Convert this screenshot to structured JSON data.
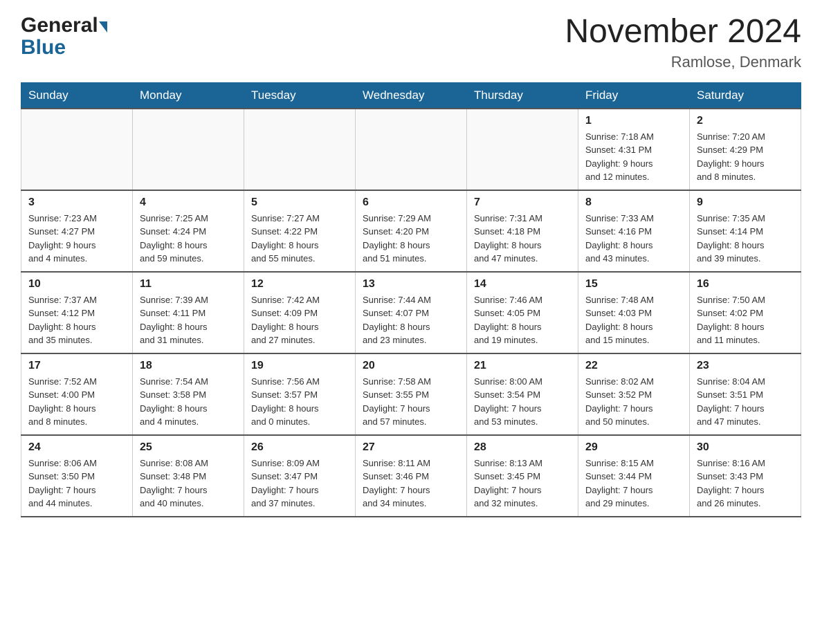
{
  "header": {
    "logo_general": "General",
    "logo_blue": "Blue",
    "month_title": "November 2024",
    "location": "Ramlose, Denmark"
  },
  "weekdays": [
    "Sunday",
    "Monday",
    "Tuesday",
    "Wednesday",
    "Thursday",
    "Friday",
    "Saturday"
  ],
  "weeks": [
    [
      {
        "day": "",
        "info": ""
      },
      {
        "day": "",
        "info": ""
      },
      {
        "day": "",
        "info": ""
      },
      {
        "day": "",
        "info": ""
      },
      {
        "day": "",
        "info": ""
      },
      {
        "day": "1",
        "info": "Sunrise: 7:18 AM\nSunset: 4:31 PM\nDaylight: 9 hours\nand 12 minutes."
      },
      {
        "day": "2",
        "info": "Sunrise: 7:20 AM\nSunset: 4:29 PM\nDaylight: 9 hours\nand 8 minutes."
      }
    ],
    [
      {
        "day": "3",
        "info": "Sunrise: 7:23 AM\nSunset: 4:27 PM\nDaylight: 9 hours\nand 4 minutes."
      },
      {
        "day": "4",
        "info": "Sunrise: 7:25 AM\nSunset: 4:24 PM\nDaylight: 8 hours\nand 59 minutes."
      },
      {
        "day": "5",
        "info": "Sunrise: 7:27 AM\nSunset: 4:22 PM\nDaylight: 8 hours\nand 55 minutes."
      },
      {
        "day": "6",
        "info": "Sunrise: 7:29 AM\nSunset: 4:20 PM\nDaylight: 8 hours\nand 51 minutes."
      },
      {
        "day": "7",
        "info": "Sunrise: 7:31 AM\nSunset: 4:18 PM\nDaylight: 8 hours\nand 47 minutes."
      },
      {
        "day": "8",
        "info": "Sunrise: 7:33 AM\nSunset: 4:16 PM\nDaylight: 8 hours\nand 43 minutes."
      },
      {
        "day": "9",
        "info": "Sunrise: 7:35 AM\nSunset: 4:14 PM\nDaylight: 8 hours\nand 39 minutes."
      }
    ],
    [
      {
        "day": "10",
        "info": "Sunrise: 7:37 AM\nSunset: 4:12 PM\nDaylight: 8 hours\nand 35 minutes."
      },
      {
        "day": "11",
        "info": "Sunrise: 7:39 AM\nSunset: 4:11 PM\nDaylight: 8 hours\nand 31 minutes."
      },
      {
        "day": "12",
        "info": "Sunrise: 7:42 AM\nSunset: 4:09 PM\nDaylight: 8 hours\nand 27 minutes."
      },
      {
        "day": "13",
        "info": "Sunrise: 7:44 AM\nSunset: 4:07 PM\nDaylight: 8 hours\nand 23 minutes."
      },
      {
        "day": "14",
        "info": "Sunrise: 7:46 AM\nSunset: 4:05 PM\nDaylight: 8 hours\nand 19 minutes."
      },
      {
        "day": "15",
        "info": "Sunrise: 7:48 AM\nSunset: 4:03 PM\nDaylight: 8 hours\nand 15 minutes."
      },
      {
        "day": "16",
        "info": "Sunrise: 7:50 AM\nSunset: 4:02 PM\nDaylight: 8 hours\nand 11 minutes."
      }
    ],
    [
      {
        "day": "17",
        "info": "Sunrise: 7:52 AM\nSunset: 4:00 PM\nDaylight: 8 hours\nand 8 minutes."
      },
      {
        "day": "18",
        "info": "Sunrise: 7:54 AM\nSunset: 3:58 PM\nDaylight: 8 hours\nand 4 minutes."
      },
      {
        "day": "19",
        "info": "Sunrise: 7:56 AM\nSunset: 3:57 PM\nDaylight: 8 hours\nand 0 minutes."
      },
      {
        "day": "20",
        "info": "Sunrise: 7:58 AM\nSunset: 3:55 PM\nDaylight: 7 hours\nand 57 minutes."
      },
      {
        "day": "21",
        "info": "Sunrise: 8:00 AM\nSunset: 3:54 PM\nDaylight: 7 hours\nand 53 minutes."
      },
      {
        "day": "22",
        "info": "Sunrise: 8:02 AM\nSunset: 3:52 PM\nDaylight: 7 hours\nand 50 minutes."
      },
      {
        "day": "23",
        "info": "Sunrise: 8:04 AM\nSunset: 3:51 PM\nDaylight: 7 hours\nand 47 minutes."
      }
    ],
    [
      {
        "day": "24",
        "info": "Sunrise: 8:06 AM\nSunset: 3:50 PM\nDaylight: 7 hours\nand 44 minutes."
      },
      {
        "day": "25",
        "info": "Sunrise: 8:08 AM\nSunset: 3:48 PM\nDaylight: 7 hours\nand 40 minutes."
      },
      {
        "day": "26",
        "info": "Sunrise: 8:09 AM\nSunset: 3:47 PM\nDaylight: 7 hours\nand 37 minutes."
      },
      {
        "day": "27",
        "info": "Sunrise: 8:11 AM\nSunset: 3:46 PM\nDaylight: 7 hours\nand 34 minutes."
      },
      {
        "day": "28",
        "info": "Sunrise: 8:13 AM\nSunset: 3:45 PM\nDaylight: 7 hours\nand 32 minutes."
      },
      {
        "day": "29",
        "info": "Sunrise: 8:15 AM\nSunset: 3:44 PM\nDaylight: 7 hours\nand 29 minutes."
      },
      {
        "day": "30",
        "info": "Sunrise: 8:16 AM\nSunset: 3:43 PM\nDaylight: 7 hours\nand 26 minutes."
      }
    ]
  ]
}
